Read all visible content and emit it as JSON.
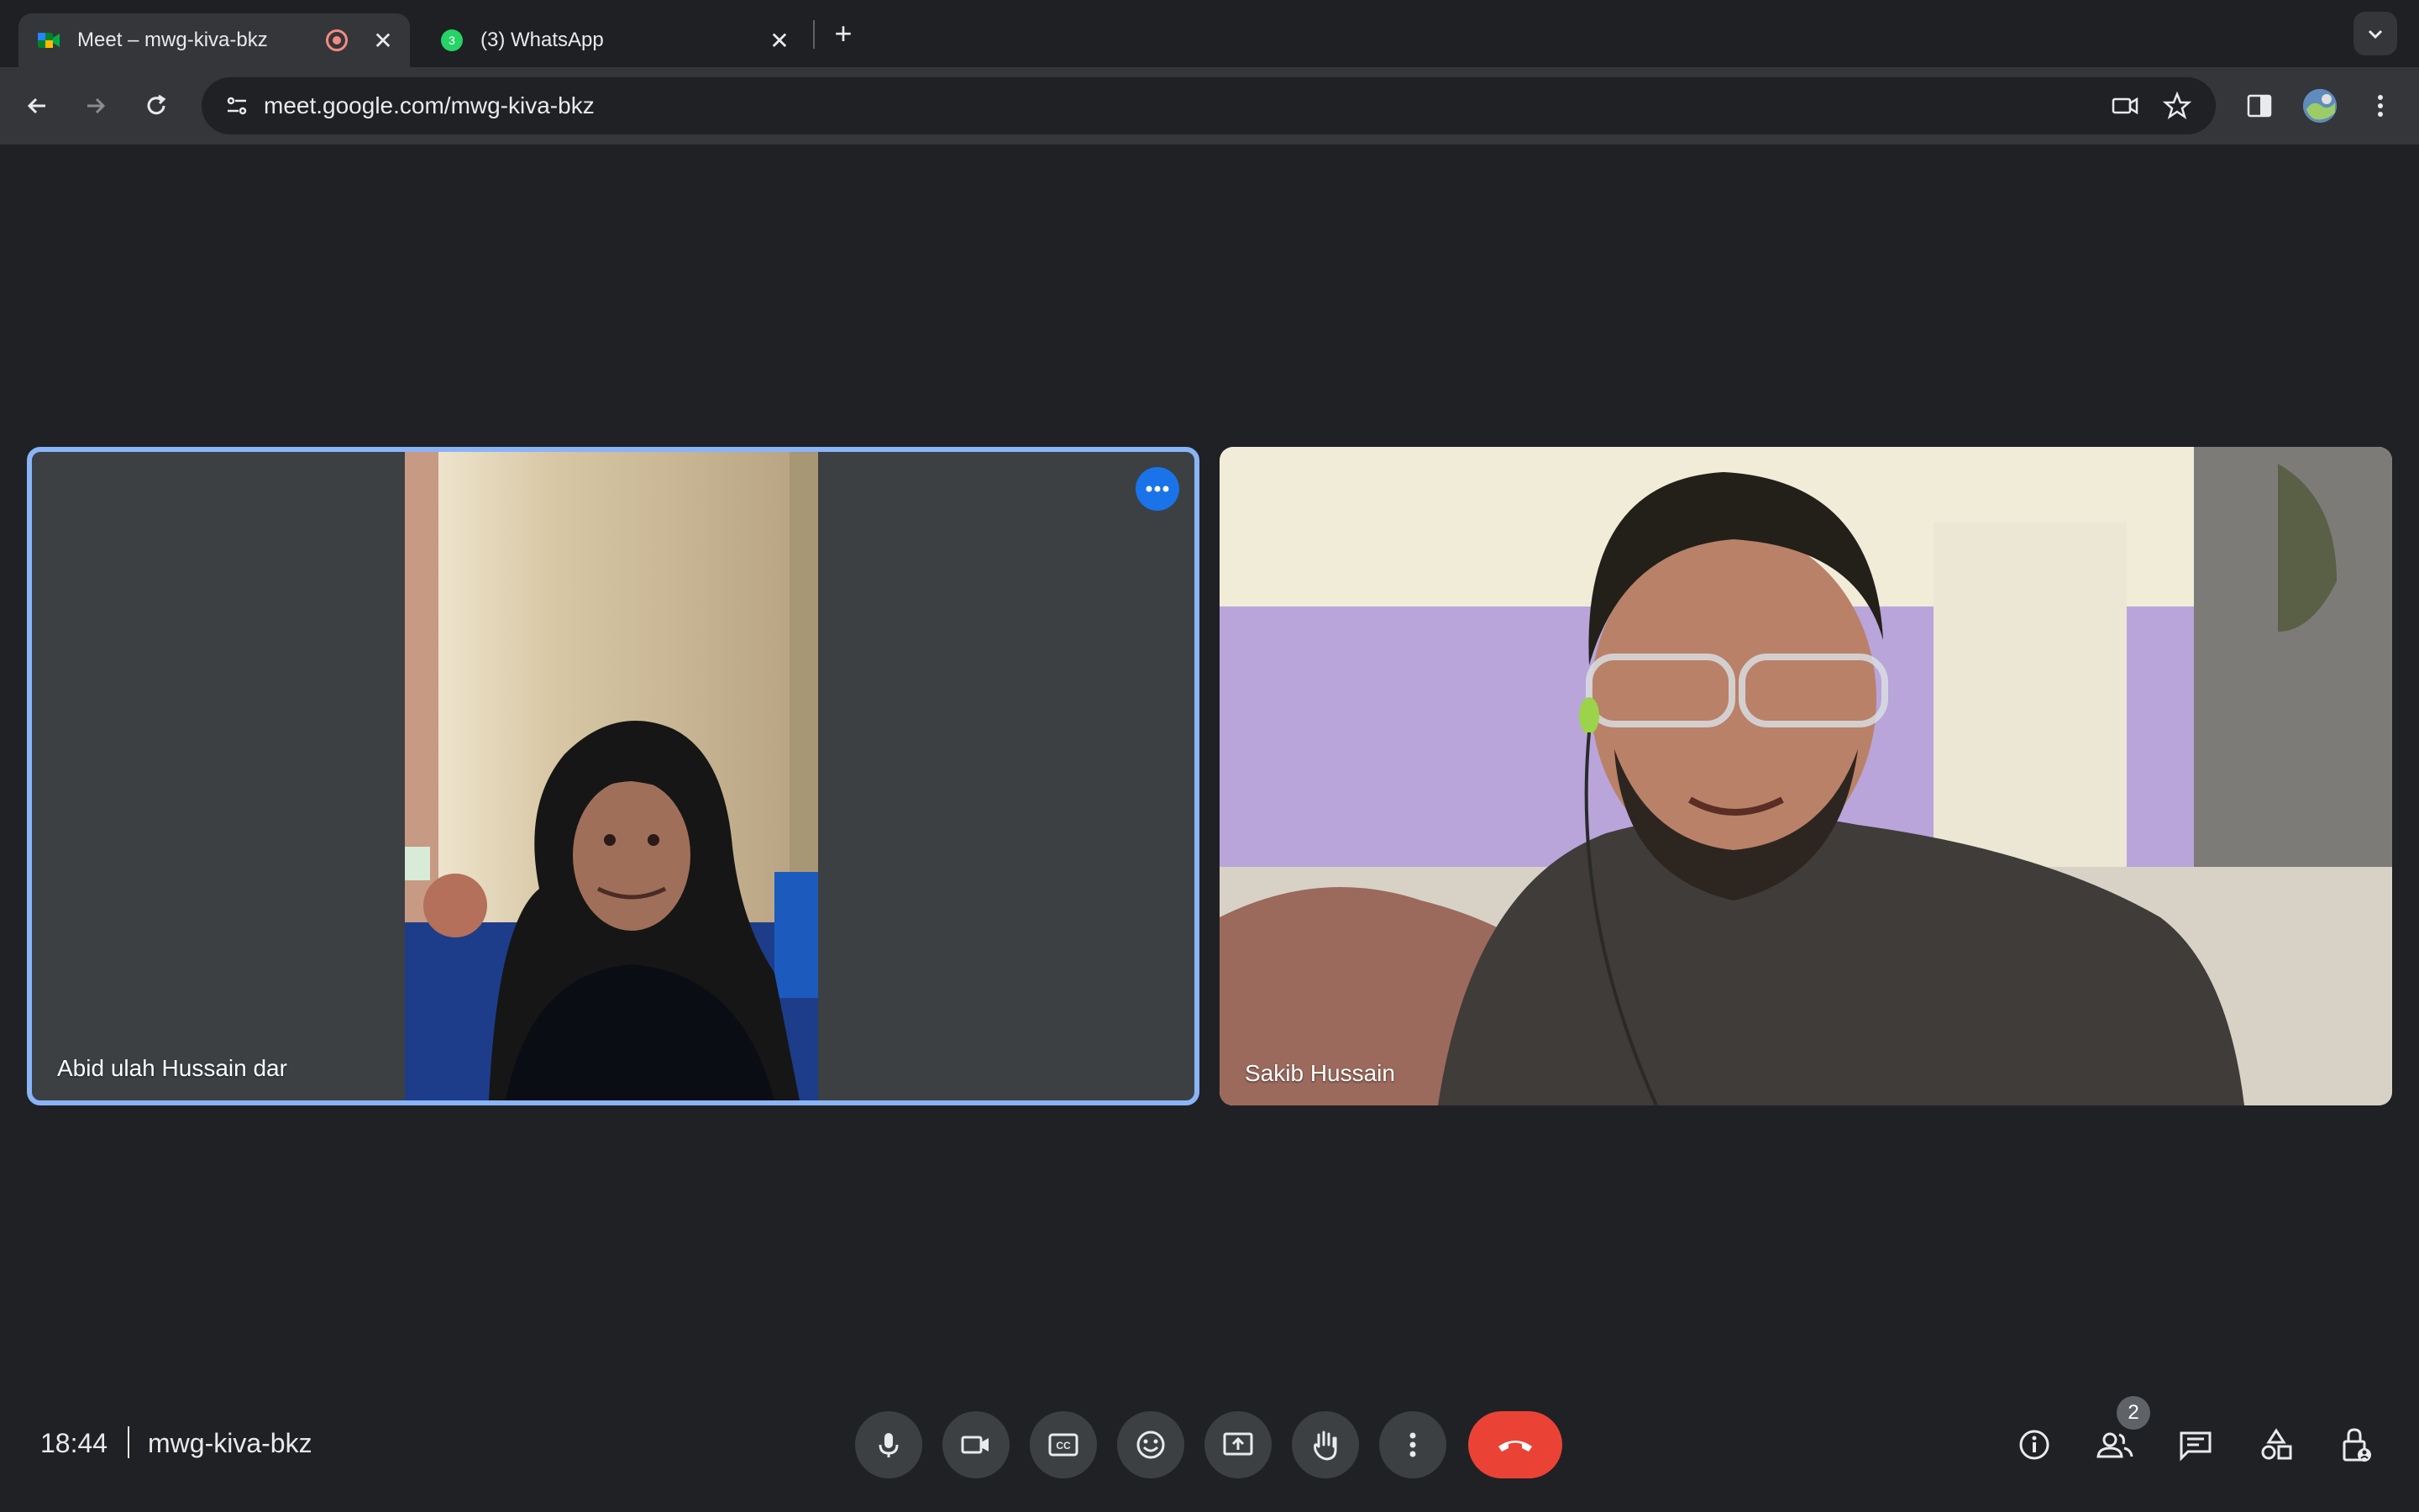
{
  "browser": {
    "tabs": [
      {
        "title": "Meet – mwg-kiva-bkz",
        "active": true,
        "recording": true
      },
      {
        "title": "(3) WhatsApp",
        "active": false,
        "badge": "3"
      }
    ],
    "url": "meet.google.com/mwg-kiva-bkz"
  },
  "meeting": {
    "time": "18:44",
    "code": "mwg-kiva-bkz",
    "participant_count": "2",
    "participants": [
      {
        "name": "Abid ulah Hussain dar"
      },
      {
        "name": "Sakib Hussain"
      }
    ]
  },
  "colors": {
    "accent": "#8ab4f8",
    "hangup": "#ea4335",
    "control_bg": "#3c4043",
    "background": "#202124"
  },
  "icons": {
    "controls": [
      "microphone-icon",
      "camera-icon",
      "captions-icon",
      "emoji-icon",
      "present-icon",
      "raise-hand-icon",
      "more-options-icon",
      "hangup-icon"
    ],
    "side": [
      "info-icon",
      "people-icon",
      "chat-icon",
      "activities-icon",
      "host-controls-icon"
    ]
  }
}
